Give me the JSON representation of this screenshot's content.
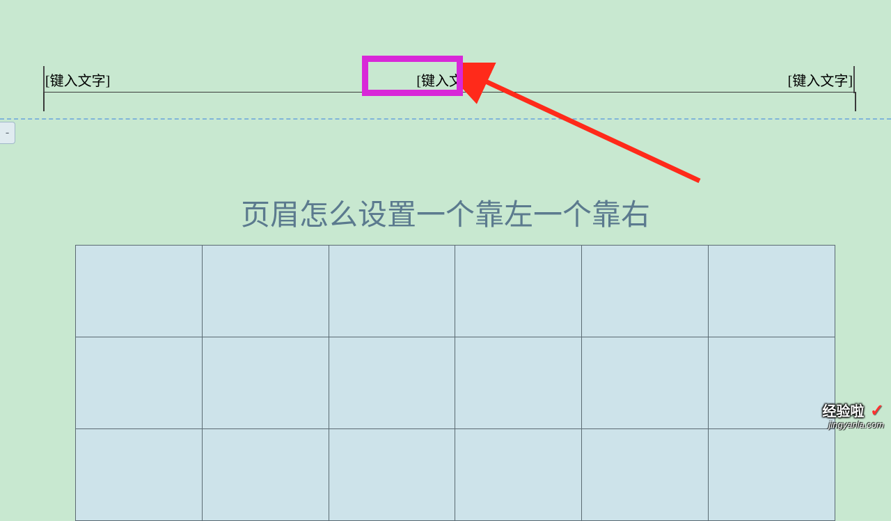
{
  "header": {
    "left": "[键入文字]",
    "center": "[键入文字]",
    "right": "[键入文字]"
  },
  "collapse_button": "-",
  "title": "页眉怎么设置一个靠左一个靠右",
  "watermark": {
    "name": "经验啦",
    "check": "✓",
    "url": "jingyanla.com"
  }
}
